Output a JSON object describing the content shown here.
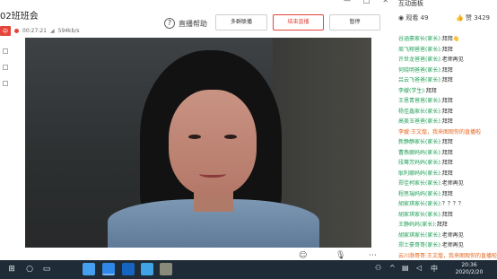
{
  "window": {
    "title": "02班班会",
    "live_badge": "中",
    "elapsed": "00:27:21",
    "bitrate": "594kb/s",
    "help_label": "直播帮助",
    "buttons": {
      "multi": "多群联播",
      "end": "结束直播",
      "pause": "暂停"
    }
  },
  "panel": {
    "title": "互动面板",
    "views_label": "观看",
    "views_count": "49",
    "likes_label": "赞",
    "likes_count": "3429"
  },
  "chat": [
    {
      "who": "谷涵豪家长(家长):",
      "text": "拜拜👋"
    },
    {
      "who": "周飞翔爸爸(家长):",
      "text": "拜拜"
    },
    {
      "who": "许世龙爸爸(家长):",
      "text": "老师再见"
    },
    {
      "who": "何晓明爸爸(家长):",
      "text": "拜拜"
    },
    {
      "who": "吕云飞爸爸(家长):",
      "text": "拜拜"
    },
    {
      "who": "李嫒(学生):",
      "text": "拜拜"
    },
    {
      "who": "王恩青爸爸(家长):",
      "text": "拜拜"
    },
    {
      "who": "杨佳鑫家长(家长):",
      "text": "拜拜"
    },
    {
      "who": "高美玉爸爸(家长):",
      "text": "拜拜"
    },
    {
      "who": "李嫒:",
      "text": "王文煌，我来图观你的直播啦",
      "orange": true
    },
    {
      "who": "新静静家长(家长):",
      "text": "拜拜"
    },
    {
      "who": "曹燕娜妈妈(家长):",
      "text": "拜拜"
    },
    {
      "who": "段骞芳妈妈(家长):",
      "text": "拜拜"
    },
    {
      "who": "耿利娜妈妈(家长):",
      "text": "拜拜"
    },
    {
      "who": "郑佳柯家长(家长):",
      "text": "老师再见"
    },
    {
      "who": "程思瑞妈妈(家长):",
      "text": "拜拜"
    },
    {
      "who": "胡家琪家长(家长):",
      "text": "？？？？"
    },
    {
      "who": "胡家琪家长(家长):",
      "text": "拜拜"
    },
    {
      "who": "王静妈妈(家长):",
      "text": "拜拜"
    },
    {
      "who": "胡家琪家长(家长):",
      "text": "老师再见"
    },
    {
      "who": "郑士豪哥哥(家长):",
      "text": "老师再见"
    },
    {
      "who": "云川渤哥哥:",
      "text": "王文煌，我来图观你的直播啦",
      "orange": true
    }
  ],
  "taskbar": {
    "time": "20:36",
    "date": "2020/2/20"
  },
  "colors": {
    "accent_red": "#e4453a",
    "chat_name_green": "#24a05a",
    "chat_name_orange": "#e6641e",
    "taskbar_bg": "#1f2b36"
  },
  "icons": {
    "help": "question-circle-icon",
    "views": "eye-icon",
    "likes": "thumbs-up-icon",
    "start": "windows-start-icon"
  }
}
